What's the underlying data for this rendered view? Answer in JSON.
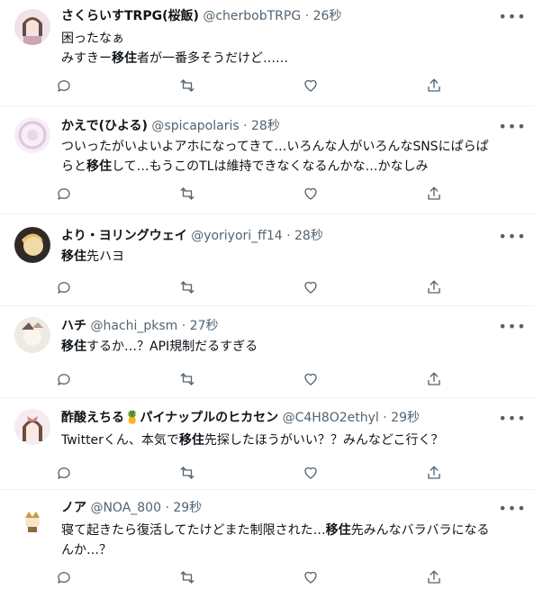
{
  "tweets": [
    {
      "name": "さくらいすTRPG(桜飯)",
      "handle": "@cherbobTRPG",
      "time": "26秒",
      "lines": [
        [
          "困ったなぁ"
        ],
        [
          "みすきー",
          "移住",
          "者が一番多そうだけど……"
        ]
      ]
    },
    {
      "name": "かえで(ひよる)",
      "handle": "@spicapolaris",
      "time": "28秒",
      "lines": [
        [
          "ついったがいよいよアホになってきて…いろんな人がいろんなSNSにぱらぱ"
        ],
        [
          "らと",
          "移住",
          "して…もうこのTLは維持できなくなるんかな…かなしみ"
        ]
      ]
    },
    {
      "name": "より・ヨリングウェイ",
      "handle": "@yoriyori_ff14",
      "time": "28秒",
      "lines": [
        [
          "",
          "移住",
          "先ハヨ"
        ]
      ]
    },
    {
      "name": "ハチ",
      "handle": "@hachi_pksm",
      "time": "27秒",
      "lines": [
        [
          "",
          "移住",
          "するか…？API規制だるすぎる"
        ]
      ]
    },
    {
      "name": "酢酸えちる🍍パイナップルのヒカセン",
      "handle": "@C4H8O2ethyl",
      "time": "29秒",
      "lines": [
        [
          "Twitterくん、本気で",
          "移住",
          "先探したほうがいい？？みんなどこ行く？"
        ]
      ]
    },
    {
      "name": "ノア",
      "handle": "@NOA_800",
      "time": "29秒",
      "lines": [
        [
          "寝て起きたら復活してたけどまた制限された…",
          "移住",
          "先みんなバラバラになる"
        ],
        [
          "んか…？"
        ]
      ]
    }
  ],
  "separator": "·",
  "more_icon": "more-horizontal-icon",
  "action_icons": [
    "reply-icon",
    "retweet-icon",
    "like-icon",
    "share-icon"
  ],
  "colors": {
    "text": "#0f1419",
    "muted": "#536471",
    "border": "#eff3f4"
  }
}
